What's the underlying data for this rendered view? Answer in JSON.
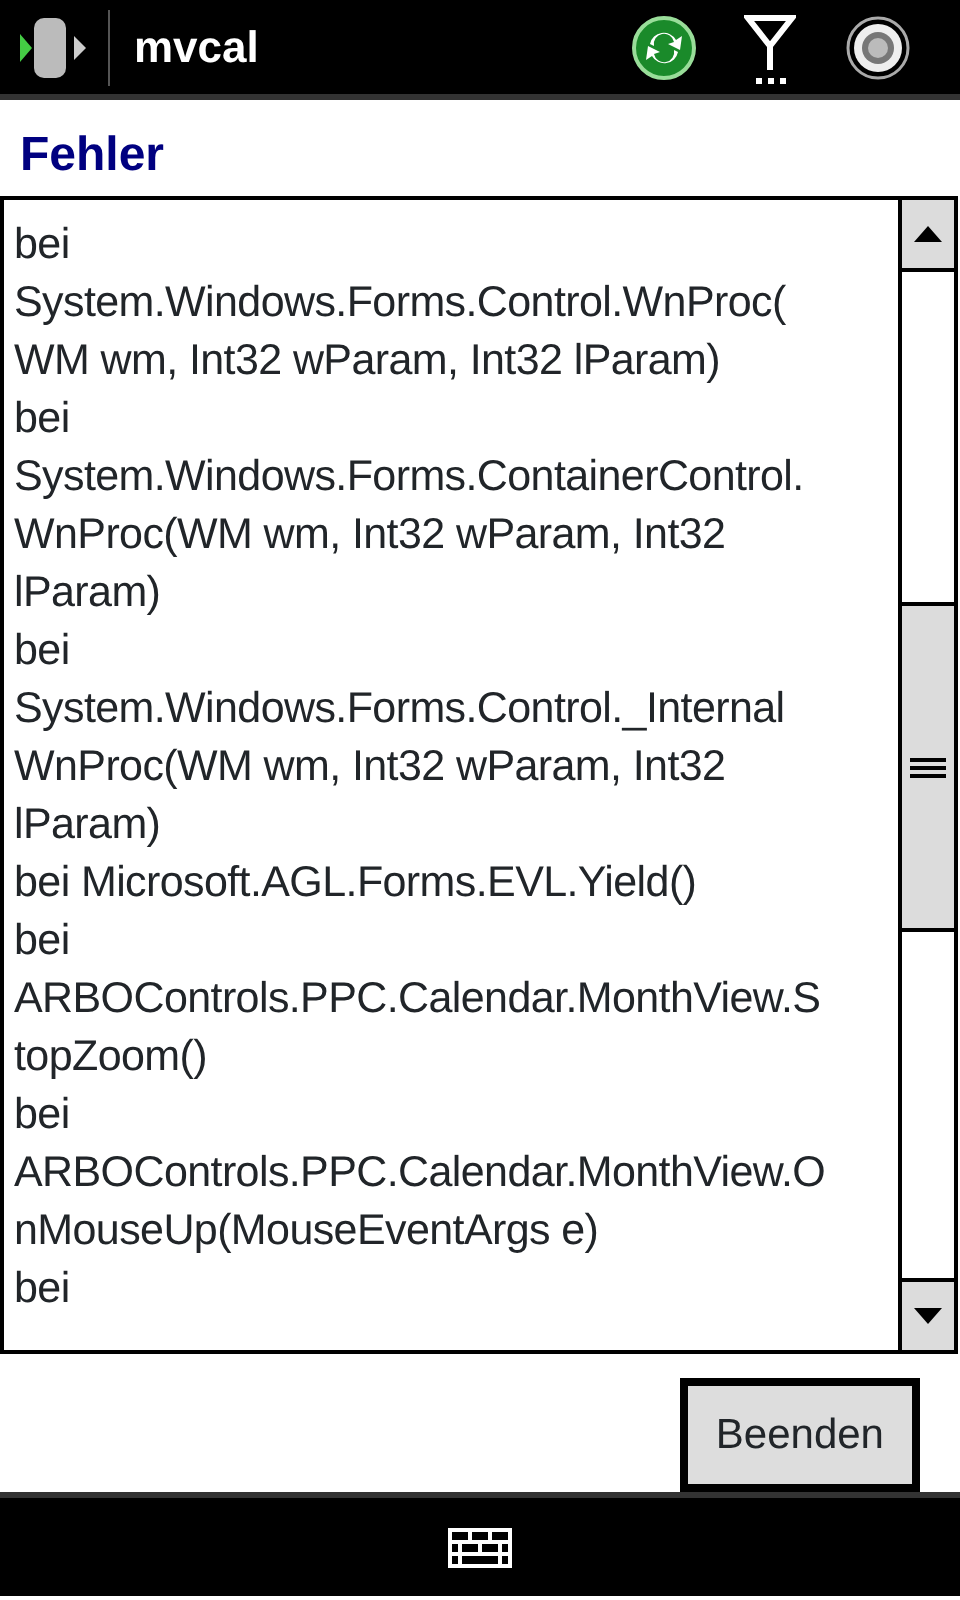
{
  "status_bar": {
    "app_title": "mvcal"
  },
  "dialog": {
    "title": "Fehler",
    "message_lines": [
      "bei",
      "System.Windows.Forms.Control.WnProc(",
      "WM wm, Int32 wParam, Int32 lParam)",
      "bei",
      "System.Windows.Forms.ContainerControl.",
      "WnProc(WM wm, Int32 wParam, Int32",
      "lParam)",
      "bei",
      "System.Windows.Forms.Control._Internal",
      "WnProc(WM wm, Int32 wParam, Int32",
      "lParam)",
      "bei Microsoft.AGL.Forms.EVL.Yield()",
      "bei",
      "ARBOControls.PPC.Calendar.MonthView.S",
      "topZoom()",
      "bei",
      "ARBOControls.PPC.Calendar.MonthView.O",
      "nMouseUp(MouseEventArgs e)",
      "bei"
    ],
    "buttons": [
      "Beenden"
    ]
  }
}
